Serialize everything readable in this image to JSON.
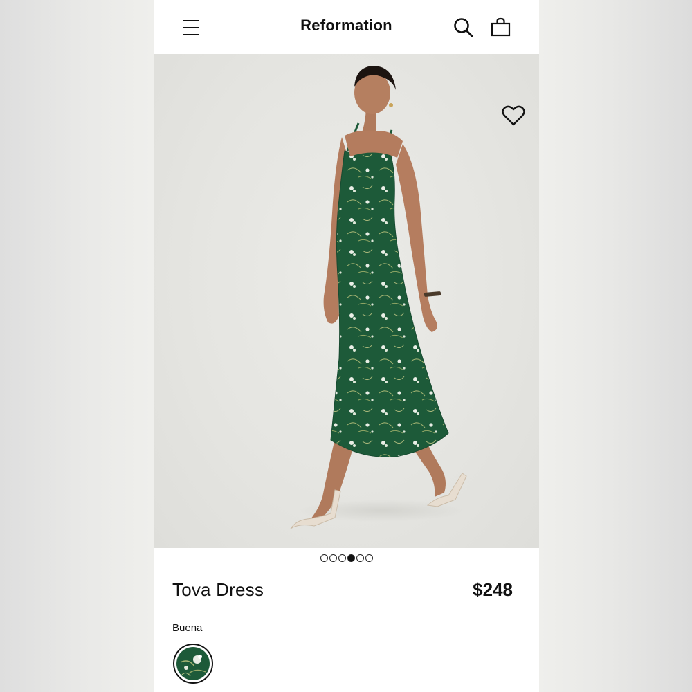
{
  "header": {
    "brand": "Reformation",
    "icons": [
      "menu-icon",
      "search-icon",
      "bag-icon"
    ]
  },
  "gallery": {
    "total_images": 6,
    "active_index": 3,
    "favorite_icon": "heart-icon"
  },
  "product": {
    "name": "Tova Dress",
    "price": "$248",
    "color_name": "Buena"
  },
  "colors": {
    "brand_text": "#111111",
    "dress_green": "#1f5a3a",
    "photo_background": "#e6e6e2"
  }
}
